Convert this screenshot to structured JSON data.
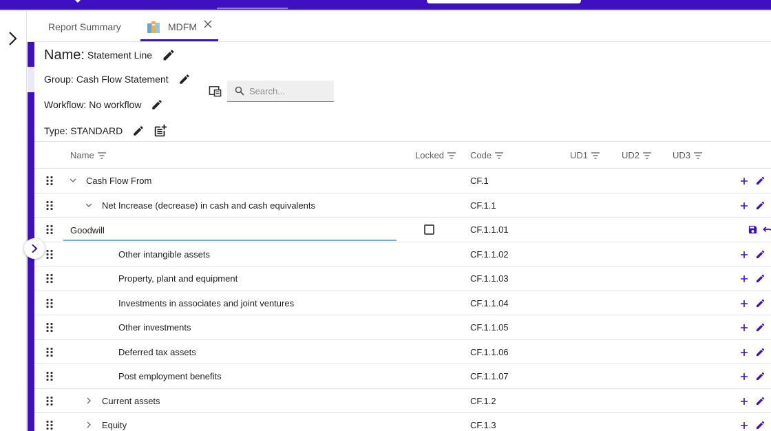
{
  "colors": {
    "brand": "#3f10c2",
    "active_input_underline": "#6bb6d6"
  },
  "tabs": [
    {
      "label": "Report Summary"
    },
    {
      "label": "MDFM",
      "icon": "books-icon",
      "closable": true
    }
  ],
  "header": {
    "name_label": "Name:",
    "name_value": "Statement Line",
    "group_label": "Group:",
    "group_value": "Cash Flow Statement",
    "workflow_label": "Workflow:",
    "workflow_value": "No workflow",
    "type_label": "Type:",
    "type_value": "STANDARD"
  },
  "search": {
    "placeholder": "Search...",
    "value": ""
  },
  "columns": {
    "name": "Name",
    "locked": "Locked",
    "code": "Code",
    "ud1": "UD1",
    "ud2": "UD2",
    "ud3": "UD3"
  },
  "rows": [
    {
      "name": "Cash Flow From",
      "code": "CF.1",
      "level": 0,
      "expander": "expanded"
    },
    {
      "name": "Net Increase (decrease) in cash and cash equivalents",
      "code": "CF.1.1",
      "level": 1,
      "expander": "expanded"
    },
    {
      "name": "Goodwill",
      "code": "CF.1.1.01",
      "level": 2,
      "editing": true,
      "locked": false
    },
    {
      "name": "Other intangible assets",
      "code": "CF.1.1.02",
      "level": 2
    },
    {
      "name": "Property, plant and equipment",
      "code": "CF.1.1.03",
      "level": 2
    },
    {
      "name": "Investments in associates and joint ventures",
      "code": "CF.1.1.04",
      "level": 2
    },
    {
      "name": "Other investments",
      "code": "CF.1.1.05",
      "level": 2
    },
    {
      "name": "Deferred tax assets",
      "code": "CF.1.1.06",
      "level": 2
    },
    {
      "name": "Post employment benefits",
      "code": "CF.1.1.07",
      "level": 2
    },
    {
      "name": "Current assets",
      "code": "CF.1.2",
      "level": 1,
      "expander": "collapsed"
    },
    {
      "name": "Equity",
      "code": "CF.1.3",
      "level": 1,
      "expander": "collapsed"
    }
  ]
}
